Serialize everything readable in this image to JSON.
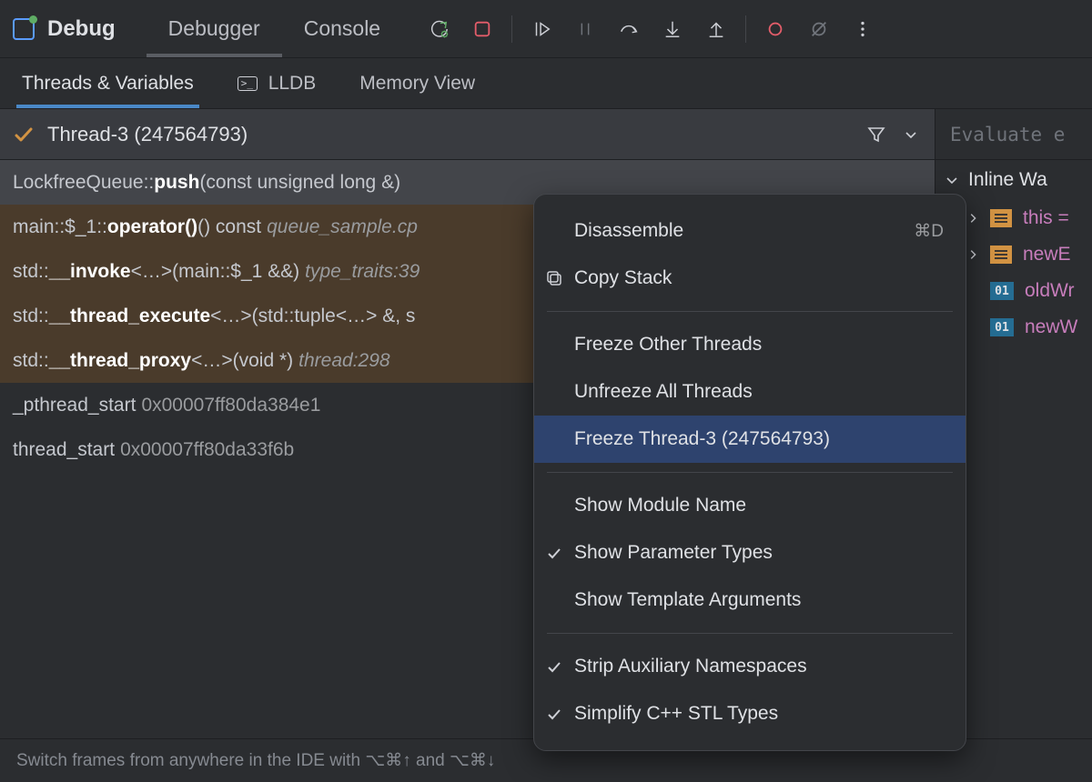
{
  "header": {
    "title": "Debug",
    "tabs": [
      "Debugger",
      "Console"
    ]
  },
  "sub_tabs": [
    "Threads & Variables",
    "LLDB",
    "Memory View"
  ],
  "thread_bar": {
    "label": "Thread-3 (247564793)"
  },
  "frames": [
    {
      "cls": "LockfreeQueue::",
      "fn": "push",
      "sig": "(const unsigned long &) ",
      "src": ""
    },
    {
      "cls": "main::$_1::",
      "fn": "operator()",
      "sig": "() const ",
      "src": "queue_sample.cp"
    },
    {
      "cls": "std::",
      "fn": "__invoke",
      "sig": "<…>(main::$_1 &&) ",
      "src": "type_traits:39"
    },
    {
      "cls": "std::",
      "fn": "__thread_execute",
      "sig": "<…>(std::tuple<…> &, s",
      "src": ""
    },
    {
      "cls": "std::",
      "fn": "__thread_proxy",
      "sig": "<…>(void *) ",
      "src": "thread:298"
    },
    {
      "cls": "_pthread_start ",
      "fn": "",
      "sig": "",
      "addr": "0x00007ff80da384e1"
    },
    {
      "cls": "thread_start ",
      "fn": "",
      "sig": "",
      "addr": "0x00007ff80da33f6b"
    }
  ],
  "eval_placeholder": "Evaluate e",
  "vars": {
    "section": "Inline Wa",
    "items": [
      {
        "kind": "obj",
        "name": "this =",
        "expandable": true
      },
      {
        "kind": "obj",
        "name": "newE",
        "expandable": true
      },
      {
        "kind": "num",
        "name": "oldWr",
        "expandable": false
      },
      {
        "kind": "num",
        "name": "newW",
        "expandable": false
      }
    ]
  },
  "ctx_menu": {
    "groups": [
      [
        {
          "label": "Disassemble",
          "shortcut": "⌘D",
          "icon": "none"
        },
        {
          "label": "Copy Stack",
          "icon": "copy"
        }
      ],
      [
        {
          "label": "Freeze Other Threads"
        },
        {
          "label": "Unfreeze All Threads"
        },
        {
          "label": "Freeze Thread-3 (247564793)",
          "highlight": true
        }
      ],
      [
        {
          "label": "Show Module Name"
        },
        {
          "label": "Show Parameter Types",
          "checked": true
        },
        {
          "label": "Show Template Arguments"
        }
      ],
      [
        {
          "label": "Strip Auxiliary Namespaces",
          "checked": true
        },
        {
          "label": "Simplify C++ STL Types",
          "checked": true
        }
      ]
    ]
  },
  "tip": {
    "prefix": "Switch frames from anywhere in the IDE with ",
    "k1": "⌥⌘↑",
    "mid": " and ",
    "k2": "⌥⌘↓"
  }
}
